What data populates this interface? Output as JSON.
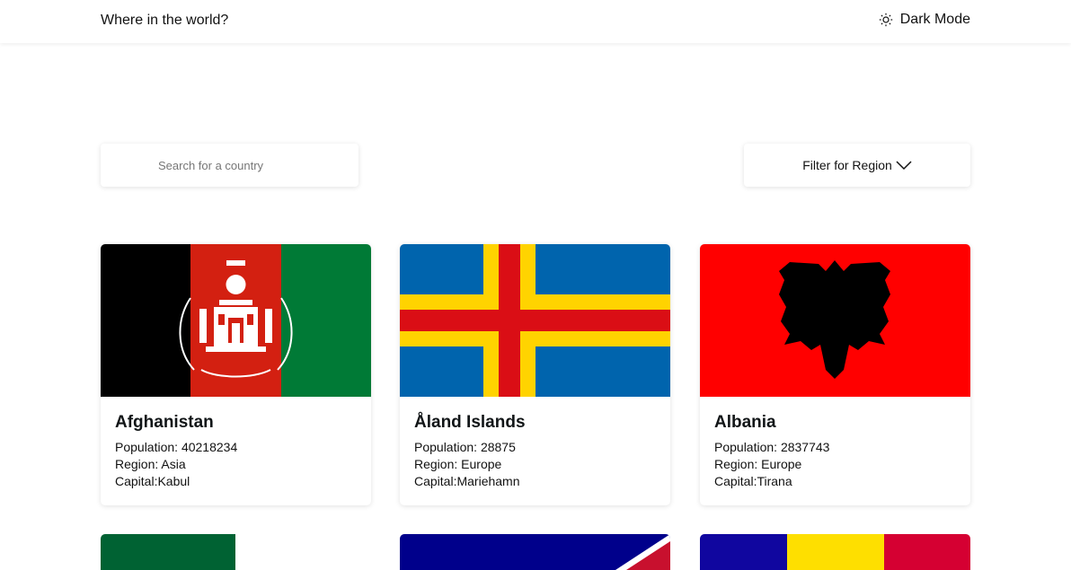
{
  "header": {
    "title": "Where in the world?",
    "theme_toggle_label": "Dark Mode"
  },
  "search": {
    "placeholder": "Search for a country",
    "value": ""
  },
  "filter": {
    "label": "Filter for Region"
  },
  "labels": {
    "population": "Population: ",
    "region": "Region: ",
    "capital": "Capital:"
  },
  "countries": [
    {
      "name": "Afghanistan",
      "population": "40218234",
      "region": "Asia",
      "capital": "Kabul"
    },
    {
      "name": "Åland Islands",
      "population": "28875",
      "region": "Europe",
      "capital": "Mariehamn"
    },
    {
      "name": "Albania",
      "population": "2837743",
      "region": "Europe",
      "capital": "Tirana"
    }
  ],
  "colors": {
    "afghanistan": [
      "#000000",
      "#d32011",
      "#007a36"
    ],
    "aland_blue": "#0064ad",
    "aland_yellow": "#ffd300",
    "aland_red": "#da0e15",
    "albania_red": "#ff0000",
    "algeria_green": "#006233",
    "samoa_blue": "#00008b",
    "andorra": [
      "#10069f",
      "#fedf00",
      "#d50032"
    ]
  },
  "icons": {
    "theme": "sun-icon",
    "filter": "chevron-down-icon"
  }
}
